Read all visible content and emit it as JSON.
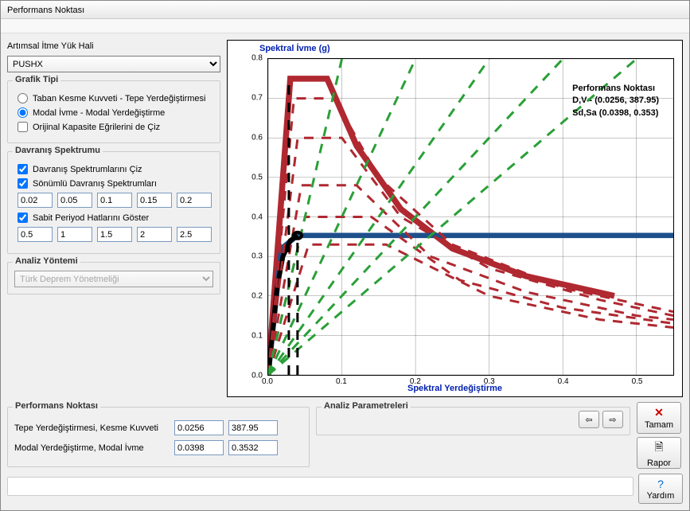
{
  "window": {
    "title": "Performans Noktası"
  },
  "left": {
    "load_label": "Artımsal İtme Yük Hali",
    "load_selected": "PUSHX",
    "grafik_tipi_title": "Grafik Tipi",
    "radio1": "Taban Kesme Kuvveti - Tepe Yerdeğiştirmesi",
    "radio2": "Modal İvme - Modal Yerdeğiştirme",
    "orig_curve": "Orijinal Kapasite Eğrilerini de Çiz",
    "davranis_title": "Davranış Spektrumu",
    "chk_spektrum": "Davranış Spektrumlarını Çiz",
    "chk_sonumlu": "Sönümlü Davranış Spektrumları",
    "sonumlu_vals": [
      "0.02",
      "0.05",
      "0.1",
      "0.15",
      "0.2"
    ],
    "chk_sabit": "Sabit Periyod Hatlarını Göster",
    "sabit_vals": [
      "0.5",
      "1",
      "1.5",
      "2",
      "2.5"
    ],
    "analiz_title": "Analiz Yöntemi",
    "analiz_selected": "Türk Deprem Yönetmeliği"
  },
  "perf": {
    "title": "Performans Noktası",
    "row1_label": "Tepe Yerdeğiştirmesi, Kesme Kuvveti",
    "row1_v1": "0.0256",
    "row1_v2": "387.95",
    "row2_label": "Modal Yerdeğiştirme, Modal İvme",
    "row2_v1": "0.0398",
    "row2_v2": "0.3532"
  },
  "analiz": {
    "title": "Analiz Parametreleri"
  },
  "buttons": {
    "tamam": "Tamam",
    "rapor": "Rapor",
    "yardim": "Yardım"
  },
  "chart_data": {
    "type": "line",
    "title_y": "Spektral İvme (g)",
    "title_x": "Spektral Yerdeğiştirme",
    "xlim": [
      0,
      0.55
    ],
    "ylim": [
      0,
      0.8
    ],
    "xticks": [
      0.0,
      0.1,
      0.2,
      0.3,
      0.4,
      0.5
    ],
    "yticks": [
      0.0,
      0.1,
      0.2,
      0.3,
      0.4,
      0.5,
      0.6,
      0.7,
      0.8
    ],
    "annotation": {
      "line1": "Performans Noktası",
      "line2": "D,V - (0.0256, 387.95)",
      "line3": "Sd,Sa (0.0398, 0.353)"
    },
    "series": [
      {
        "name": "demand_spectrum_5pct",
        "color": "#b02830",
        "width": 2.5,
        "x": [
          0.0,
          0.03,
          0.08,
          0.12,
          0.18,
          0.25,
          0.35,
          0.47
        ],
        "y": [
          0.0,
          0.75,
          0.75,
          0.58,
          0.42,
          0.32,
          0.25,
          0.2
        ]
      },
      {
        "name": "capacity_bilinear",
        "color": "#1d4f8b",
        "width": 2.2,
        "x": [
          0.0,
          0.018,
          0.0398,
          0.55
        ],
        "y": [
          0.0,
          0.32,
          0.353,
          0.353
        ]
      },
      {
        "name": "capacity_original",
        "color": "#000",
        "width": 2,
        "x": [
          0.0,
          0.012,
          0.02,
          0.03,
          0.0398
        ],
        "y": [
          0.0,
          0.22,
          0.3,
          0.34,
          0.353
        ]
      },
      {
        "name": "damped_0.02",
        "color": "#b02830",
        "dash": true,
        "width": 1,
        "x": [
          0.0,
          0.035,
          0.09,
          0.15,
          0.25,
          0.4,
          0.55
        ],
        "y": [
          0.0,
          0.7,
          0.7,
          0.5,
          0.33,
          0.22,
          0.16
        ]
      },
      {
        "name": "damped_0.05",
        "color": "#b02830",
        "dash": true,
        "width": 1,
        "x": [
          0.0,
          0.04,
          0.1,
          0.18,
          0.3,
          0.45,
          0.55
        ],
        "y": [
          0.0,
          0.6,
          0.6,
          0.4,
          0.27,
          0.19,
          0.15
        ]
      },
      {
        "name": "damped_0.10",
        "color": "#b02830",
        "dash": true,
        "width": 1,
        "x": [
          0.0,
          0.045,
          0.12,
          0.22,
          0.35,
          0.5,
          0.55
        ],
        "y": [
          0.0,
          0.48,
          0.48,
          0.3,
          0.21,
          0.15,
          0.14
        ]
      },
      {
        "name": "damped_0.15",
        "color": "#b02830",
        "dash": true,
        "width": 1,
        "x": [
          0.0,
          0.05,
          0.14,
          0.26,
          0.4,
          0.55
        ],
        "y": [
          0.0,
          0.4,
          0.4,
          0.24,
          0.17,
          0.13
        ]
      },
      {
        "name": "damped_0.20",
        "color": "#b02830",
        "dash": true,
        "width": 1,
        "x": [
          0.0,
          0.055,
          0.16,
          0.3,
          0.45,
          0.55
        ],
        "y": [
          0.0,
          0.33,
          0.33,
          0.2,
          0.14,
          0.12
        ]
      },
      {
        "name": "period_0.5",
        "color": "#2aa038",
        "dash": true,
        "width": 1,
        "x": [
          0,
          0.1
        ],
        "y": [
          0,
          0.8
        ]
      },
      {
        "name": "period_1.0",
        "color": "#2aa038",
        "dash": true,
        "width": 1,
        "x": [
          0,
          0.2
        ],
        "y": [
          0,
          0.8
        ]
      },
      {
        "name": "period_1.5",
        "color": "#2aa038",
        "dash": true,
        "width": 1,
        "x": [
          0,
          0.3
        ],
        "y": [
          0,
          0.8
        ]
      },
      {
        "name": "period_2.0",
        "color": "#2aa038",
        "dash": true,
        "width": 1,
        "x": [
          0,
          0.4
        ],
        "y": [
          0,
          0.8
        ]
      },
      {
        "name": "period_2.5",
        "color": "#2aa038",
        "dash": true,
        "width": 1,
        "x": [
          0,
          0.5
        ],
        "y": [
          0,
          0.8
        ]
      },
      {
        "name": "perf_marker_v",
        "color": "#000",
        "dash": true,
        "width": 1,
        "x": [
          0.0398,
          0.0398
        ],
        "y": [
          0,
          0.353
        ]
      },
      {
        "name": "perf_marker_v2",
        "color": "#000",
        "dash": true,
        "width": 1,
        "x": [
          0.028,
          0.028
        ],
        "y": [
          0,
          0.75
        ]
      }
    ],
    "perf_point": {
      "x": 0.0398,
      "y": 0.353
    }
  }
}
